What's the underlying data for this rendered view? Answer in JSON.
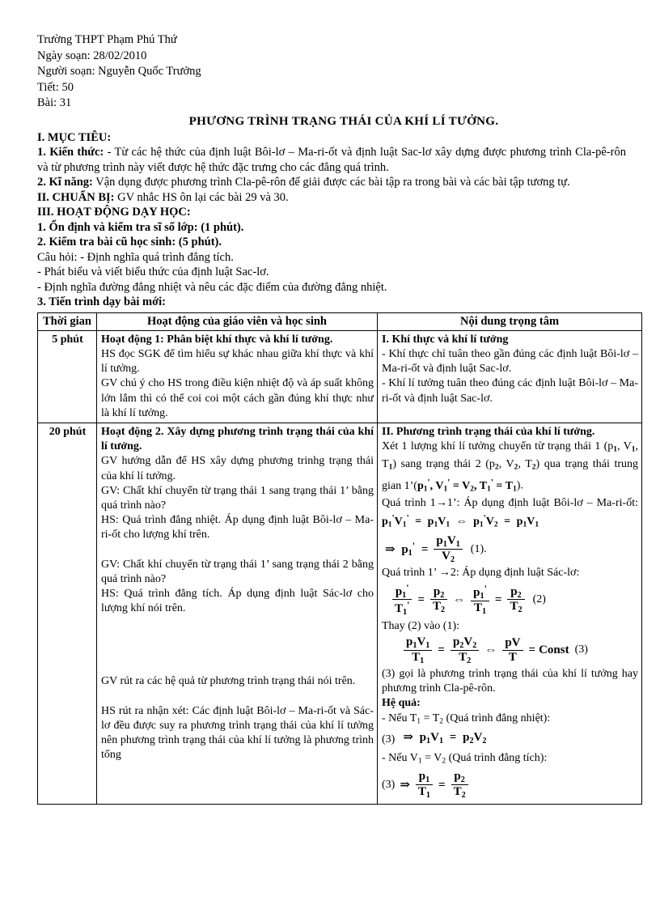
{
  "header": {
    "school": "Trường THPT Phạm Phú Thứ",
    "date_label": "Ngày soạn: 28/02/2010",
    "author_label": "Người soạn: Nguyễn  Quốc Trưởng",
    "period_label": "Tiết: 50",
    "lesson_label": "Bài: 31"
  },
  "title": "PHƯƠNG TRÌNH TRẠNG THÁI CỦA KHÍ LÍ TƯỞNG.",
  "sections": {
    "objectives_heading": "I. MỤC TIÊU:",
    "knowledge_label": "1. Kiến thức:",
    "knowledge_text": " - Từ các hệ thức của định luật Bôi-lơ – Ma-ri-ốt và định luật Sac-lơ xây dựng được phương trình Cla-pê-rôn và từ  phương trình này viết được hệ thức đặc trưng cho các đẳng quá trình.",
    "skills_label": "2. Kĩ năng:",
    "skills_text": " Vận dụng được phương trình  Cla-pê-rôn để giải  được các bài tập ra trong bài và các bài tập tương tự.",
    "prep_label": "II. CHUẨN BỊ:",
    "prep_text": " GV nhắc  HS ôn lại các bài 29 và 30.",
    "activities_heading": "III. HOẠT ĐỘNG DẠY HỌC:",
    "step1": "1. Ổn định và kiểm tra sĩ số lớp: (1 phút).",
    "step2": "2. Kiểm tra bài cũ học sinh: (5 phút).",
    "question_line1": "Câu hỏi:  - Định nghĩa  quá trình  đẳng tích.",
    "question_line2": "- Phát biểu và viết biểu thức của định luật  Sac-lơ.",
    "question_line3": "- Định nghĩa  đường đẳng nhiệt  và nêu các đặc điểm  của đường đẳng nhiệt.",
    "step3": "3. Tiến trình  dạy bài mới:"
  },
  "table": {
    "columns": [
      "Thời gian",
      "Hoạt động của giáo viên và học sinh",
      "Nội dung trọng tâm"
    ],
    "rows": [
      {
        "time": "5 phút",
        "activity": [
          {
            "bold": true,
            "text": "Hoạt động 1: Phân biệt khí thực và khí lí tưởng."
          },
          {
            "bold": false,
            "text": "HS đọc SGK để tìm hiểu  sự khác nhau  giữa khí thực và khí lí tưởng."
          },
          {
            "bold": false,
            "text": "GV chú ý cho HS trong điều kiện nhiệt độ và áp suất không lớn lắm thì có thể coi coi một cách gần đúng khí thực như là khí lí tưởng."
          }
        ],
        "content": [
          {
            "bold": true,
            "text": "I. Khí thực và khí lí tưởng"
          },
          {
            "bold": false,
            "text": "- Khí thực chỉ tuân theo gần đúng các định luật Bôi-lơ – Ma-ri-ốt và định luật Sac-lơ."
          },
          {
            "bold": false,
            "text": "- Khí lí tưởng tuân theo đúng các định luật Bôi-lơ – Ma-ri-ốt và định luật Sac-lơ."
          }
        ]
      },
      {
        "time": "20 phút",
        "activity": [
          {
            "bold": true,
            "text": "Hoạt động 2. Xây dựng phương trình trạng thái của khí lí tưởng."
          },
          {
            "bold": false,
            "text": "GV hướng dẫn để HS xây dựng phương trinhg trạng thái của khí lí tưởng."
          },
          {
            "bold": false,
            "text": "GV: Chất khí chuyển từ trạng thái 1 sang trạng thái 1’ bằng quá trình nào?"
          },
          {
            "bold": false,
            "text": "HS: Quá trình đẳng nhiệt. Áp dụng định luật Bôi-lơ – Ma-ri-ốt cho lượng khí trên."
          },
          {
            "blank": true
          },
          {
            "bold": false,
            "text": "GV: Chất khí chuyển từ trạng thái 1’ sang trạng thái 2 bằng quá trình nào?"
          },
          {
            "bold": false,
            "text": "HS: Quá trình đẳng tích. Áp dụng định luật Sác-lơ cho lượng khí nói trên."
          },
          {
            "blank": true
          },
          {
            "blank": true
          },
          {
            "blank": true
          },
          {
            "blank": true
          },
          {
            "bold": false,
            "text": "GV rút ra các hệ quả từ phương trình trạng thái nói trên."
          },
          {
            "blank": true
          },
          {
            "bold": false,
            "text": "HS rút ra nhận xét: Các định luật Bôi-lơ – Ma-ri-ốt và Sác-lơ đều được suy ra phương trình trạng thái của khí lí tưởng nên phương trình trạng thái của khí lí tưởng là phương trình tổng"
          }
        ],
        "content_heading": "II. Phương trình trạng thái của khí lí tưởng.",
        "content_text1": "Xét 1 lượng khí lí tưởng chuyển từ trạng thái 1 (p₁, V₁, T₁) sang trạng thái 2 (p₂, V₂, T₂) qua trạng thái trung gian 1’(",
        "content_text1_math": "p₁', V₁' = V₂, T₁' = T₁",
        "content_text1_end": ").",
        "process1_label": "Quá trình  1→1’: Áp dụng định luật Bôi-lơ – Ma-ri-ốt:",
        "eq_boyle": "p₁'V₁' = p₁V₁ ⇔ p₁'V₂ = p₁V₁",
        "eq1": "⇒ p₁' = p₁V₁ / V₂",
        "eq1_label": "(1).",
        "process2_label": "Quá trình  1’→2: Áp dụng định luật Sác-lơ:",
        "eq2": "p₁'/T₁' = p₂/T₂ ⇔ p₁'/T₁ = p₂/T₂",
        "eq2_label": "(2)",
        "substitute_label": "Thay (2) vào (1):",
        "eq3": "p₁V₁/T₁ = p₂V₂/T₂ ⇔ pV/T = Const",
        "eq3_label": "(3)",
        "conclusion": "(3) gọi là phương trình trạng thái của khí lí tưởng hay phương trình Cla-pê-rôn.",
        "consequence_heading": "Hệ quả:",
        "case1": "- Nếu T₁ = T₂ (Quá trình đẳng nhiệt):",
        "case1_eq_prefix": "(3)",
        "case1_eq": "⇒ p₁V₁ = p₂V₂",
        "case2": "- Nếu V₁ = V₂ (Quá trình đẳng tích):",
        "case2_eq_prefix": "(3)",
        "case2_eq": "⇒ p₁/T₁ = p₂/T₂"
      }
    ]
  }
}
